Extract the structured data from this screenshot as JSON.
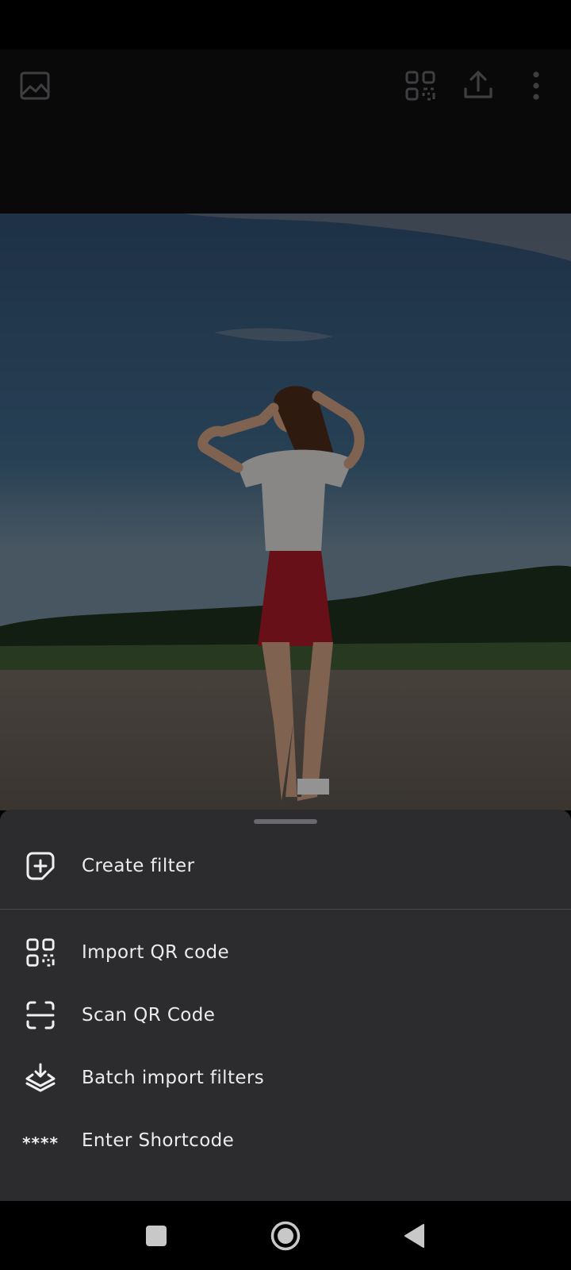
{
  "app_bar": {
    "icons": [
      "image-icon",
      "qr-code-icon",
      "share-upload-icon",
      "more-vert-icon"
    ]
  },
  "photo": {
    "description_icon": "photo-preview"
  },
  "sheet": {
    "items": [
      {
        "icon": "create-filter-icon",
        "label": "Create filter"
      },
      {
        "icon": "qr-code-icon",
        "label": "Import QR code"
      },
      {
        "icon": "scan-qr-icon",
        "label": "Scan QR Code"
      },
      {
        "icon": "batch-import-icon",
        "label": "Batch import filters"
      },
      {
        "icon": "stars-icon",
        "icon_text": "****",
        "label": "Enter Shortcode"
      }
    ]
  },
  "nav_bar": {
    "icons": [
      "recents-square-icon",
      "home-circle-icon",
      "back-triangle-icon"
    ]
  },
  "colors": {
    "sheet_bg": "#2c2c2f",
    "divider": "#4a4a4e",
    "text": "#ececec"
  }
}
